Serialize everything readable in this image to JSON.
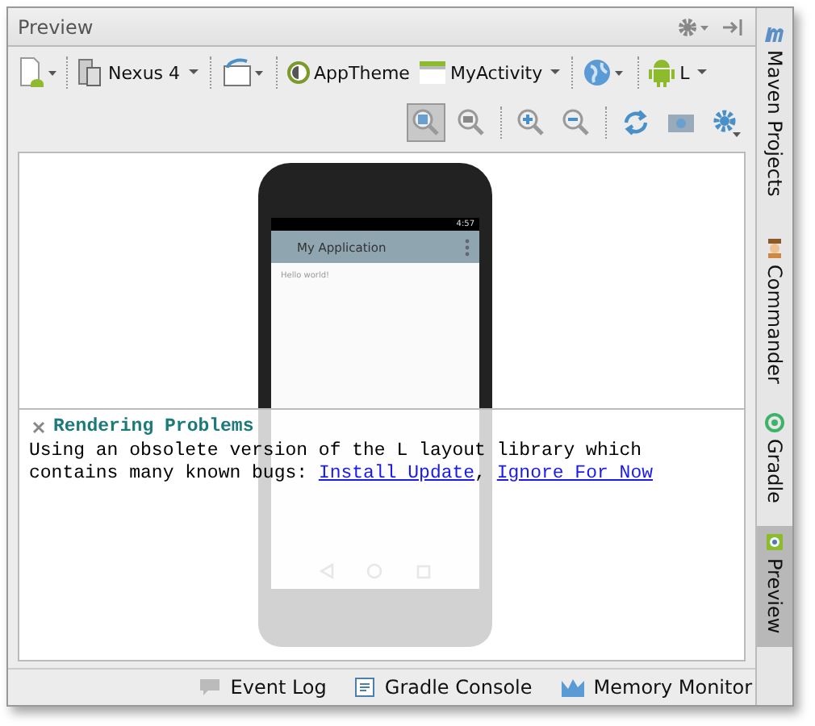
{
  "panel": {
    "title": "Preview"
  },
  "toolbar": {
    "device": "Nexus 4",
    "theme": "AppTheme",
    "activity": "MyActivity",
    "api": "L"
  },
  "view_tools": [
    {
      "kind": "zoom-fit",
      "selected": true
    },
    {
      "kind": "zoom-actual",
      "selected": false
    },
    {
      "kind": "zoom-in",
      "selected": false
    },
    {
      "kind": "zoom-out",
      "selected": false
    },
    {
      "kind": "refresh",
      "selected": false
    },
    {
      "kind": "camera",
      "selected": false
    },
    {
      "kind": "settings",
      "selected": false
    }
  ],
  "preview": {
    "app_title": "My Application",
    "body_text": "Hello world!",
    "time": "4:57"
  },
  "problems": {
    "title": "Rendering Problems",
    "message": [
      {
        "kind": "text",
        "text": "Using an obsolete version of the L layout library which contains many known bugs: "
      },
      {
        "kind": "link",
        "text": "Install Update"
      },
      {
        "kind": "text",
        "text": ", "
      },
      {
        "kind": "link",
        "text": "Ignore For Now"
      }
    ]
  },
  "side_tabs": [
    {
      "kind": "maven",
      "label": "Maven Projects",
      "selected": false
    },
    {
      "kind": "commander",
      "label": "Commander",
      "selected": false
    },
    {
      "kind": "gradle",
      "label": "Gradle",
      "selected": false
    },
    {
      "kind": "preview",
      "label": "Preview",
      "selected": true
    }
  ],
  "status_bar": [
    {
      "kind": "event-log",
      "label": "Event Log"
    },
    {
      "kind": "console",
      "label": "Gradle Console"
    },
    {
      "kind": "memory",
      "label": "Memory Monitor"
    }
  ]
}
